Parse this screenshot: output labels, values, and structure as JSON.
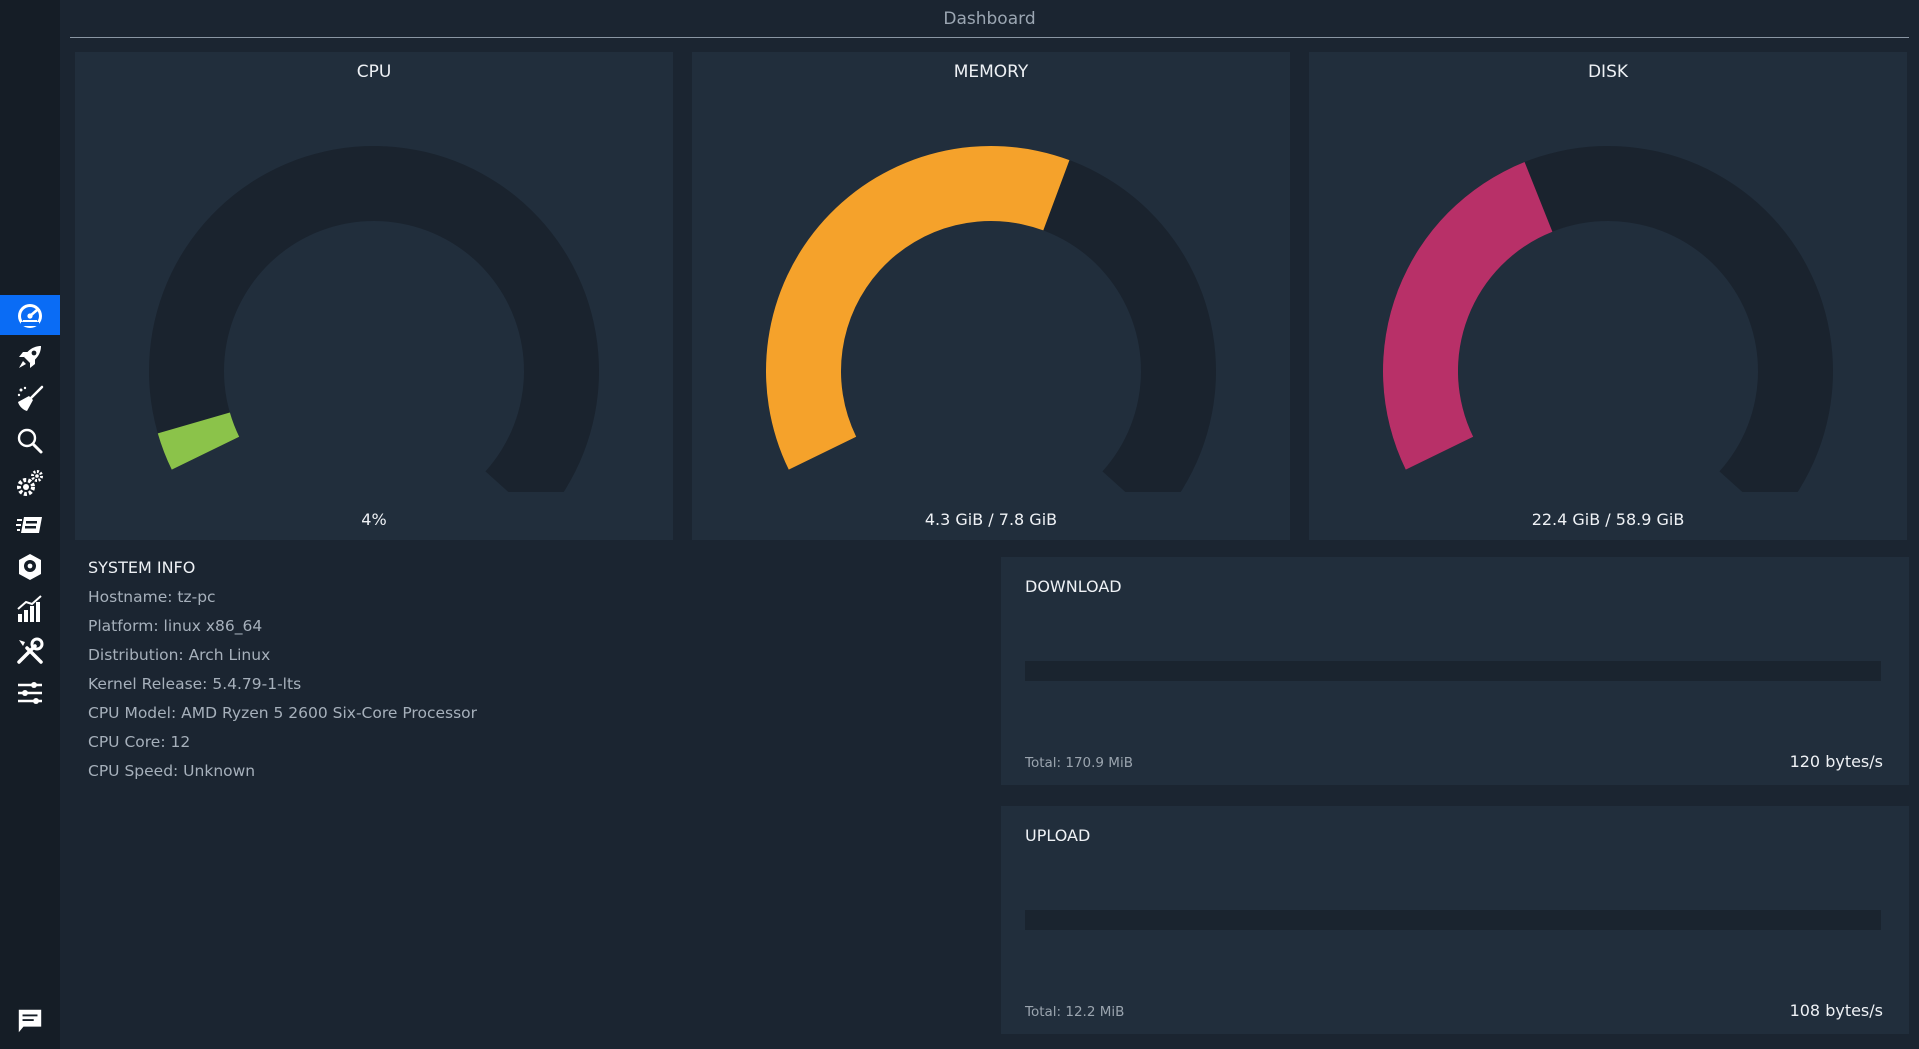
{
  "header": {
    "title": "Dashboard"
  },
  "sidebar": {
    "items": [
      {
        "icon": "dashboard-icon",
        "active": true
      },
      {
        "icon": "rocket-icon",
        "active": false
      },
      {
        "icon": "broom-icon",
        "active": false
      },
      {
        "icon": "search-icon",
        "active": false
      },
      {
        "icon": "gears-icon",
        "active": false
      },
      {
        "icon": "packages-icon",
        "active": false
      },
      {
        "icon": "disk-icon",
        "active": false
      },
      {
        "icon": "chart-icon",
        "active": false
      },
      {
        "icon": "tools-icon",
        "active": false
      },
      {
        "icon": "sliders-icon",
        "active": false
      }
    ],
    "bottom_icon": "message-icon",
    "accent": "#0a6cf5"
  },
  "gauges": {
    "cpu": {
      "title": "CPU",
      "value_text": "4%",
      "fraction": 0.04,
      "color": "#8bc34a"
    },
    "memory": {
      "title": "MEMORY",
      "value_text": "4.3 GiB / 7.8 GiB",
      "fraction": 0.55,
      "color": "#f5a22b"
    },
    "disk": {
      "title": "DISK",
      "value_text": "22.4 GiB / 58.9 GiB",
      "fraction": 0.38,
      "color": "#b83068"
    },
    "track_color": "#1a232e"
  },
  "system_info": {
    "title": "SYSTEM INFO",
    "rows": [
      "Hostname: tz-pc",
      "Platform: linux x86_64",
      "Distribution: Arch Linux",
      "Kernel Release: 5.4.79-1-lts",
      "CPU Model:  AMD Ryzen 5 2600 Six-Core Processor",
      "CPU Core: 12",
      "CPU Speed: Unknown"
    ]
  },
  "network": {
    "download": {
      "title": "DOWNLOAD",
      "total": "Total: 170.9 MiB",
      "rate": "120 bytes/s"
    },
    "upload": {
      "title": "UPLOAD",
      "total": "Total: 12.2 MiB",
      "rate": "108 bytes/s"
    }
  }
}
